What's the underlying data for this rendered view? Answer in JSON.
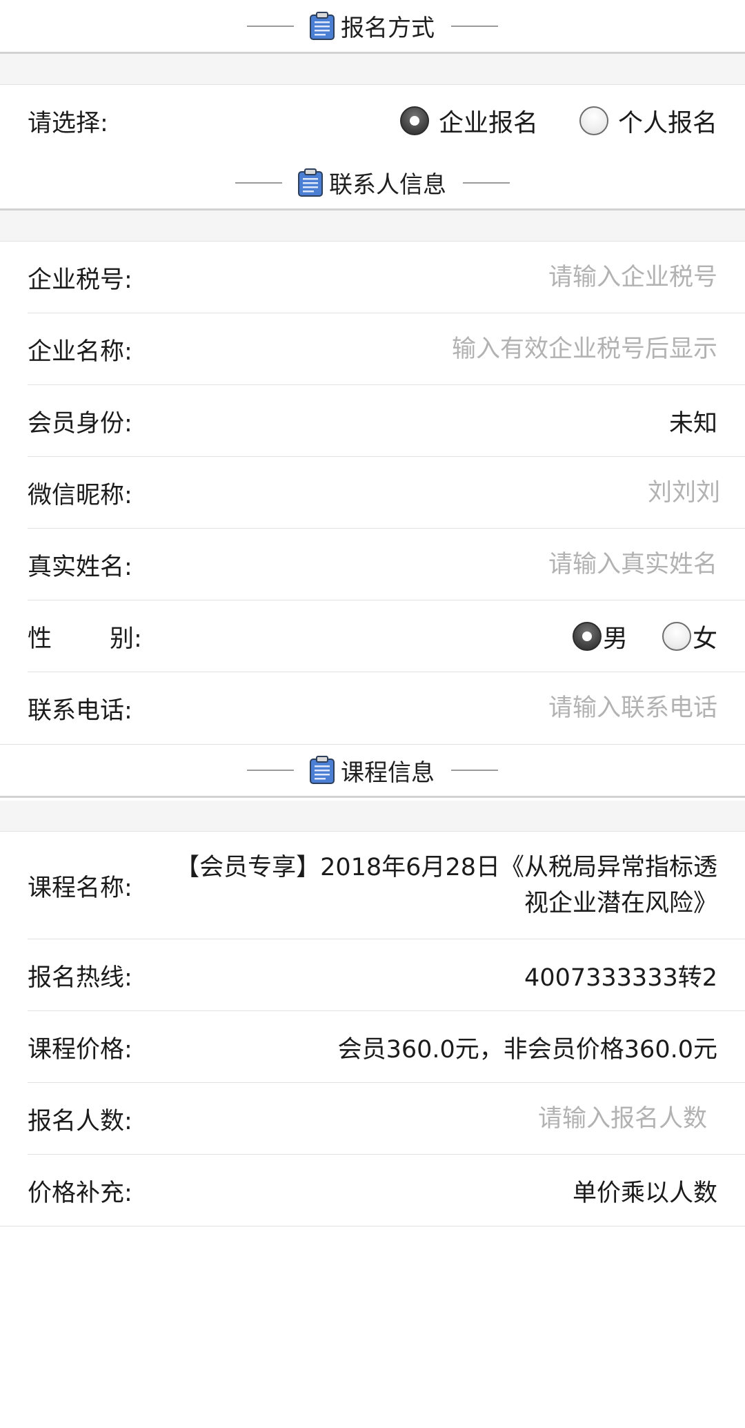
{
  "signup_method": {
    "header": "报名方式",
    "choose_label": "请选择:",
    "options": [
      "企业报名",
      "个人报名"
    ],
    "selected": "企业报名"
  },
  "contact": {
    "header": "联系人信息",
    "tax_id": {
      "label": "企业税号:",
      "placeholder": "请输入企业税号"
    },
    "company_name": {
      "label": "企业名称:",
      "placeholder": "输入有效企业税号后显示"
    },
    "member_status": {
      "label": "会员身份:",
      "value": "未知"
    },
    "wechat_nickname": {
      "label": "微信昵称:",
      "placeholder": "刘刘刘"
    },
    "real_name": {
      "label": "真实姓名:",
      "placeholder": "请输入真实姓名"
    },
    "gender": {
      "label_left": "性",
      "label_right": "别:",
      "options": [
        "男",
        "女"
      ],
      "selected": "男"
    },
    "phone": {
      "label": "联系电话:",
      "placeholder": "请输入联系电话"
    }
  },
  "course": {
    "header": "课程信息",
    "name": {
      "label": "课程名称:",
      "value": "【会员专享】2018年6月28日《从税局异常指标透视企业潜在风险》"
    },
    "hotline": {
      "label": "报名热线:",
      "value": "4007333333转2"
    },
    "price": {
      "label": "课程价格:",
      "value": "会员360.0元，非会员价格360.0元"
    },
    "count": {
      "label": "报名人数:",
      "placeholder": "请输入报名人数"
    },
    "price_note": {
      "label": "价格补充:",
      "value": "单价乘以人数"
    }
  },
  "colors": {
    "icon_blue": "#4a7fd4",
    "placeholder": "#b2b2b2",
    "divider": "#e1e1e1"
  }
}
